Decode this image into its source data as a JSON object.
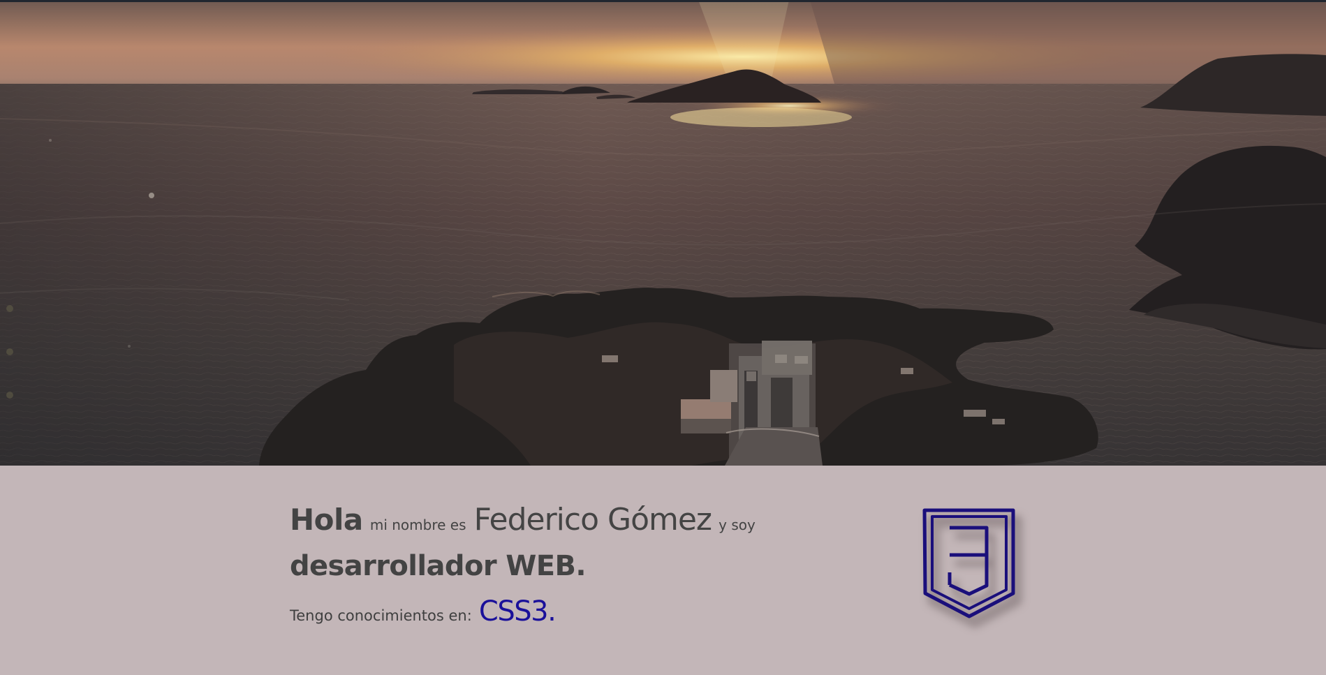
{
  "hero": {
    "image_description": "aerial-sunset-sea-islands-coastal-rocks"
  },
  "intro": {
    "hola": "Hola",
    "name_prefix": "mi nombre es",
    "name": "Federico Gómez",
    "name_suffix": "y soy",
    "role": "desarrollador WEB.",
    "knowledge_label": "Tengo conocimientos en:",
    "technology": "CSS3."
  },
  "tech_icon": {
    "name": "css3-shield-icon",
    "color": "#1a0f7b"
  },
  "theme": {
    "content_background": "#c3b6b8",
    "text_color": "#434343",
    "accent": "#1a109a"
  }
}
